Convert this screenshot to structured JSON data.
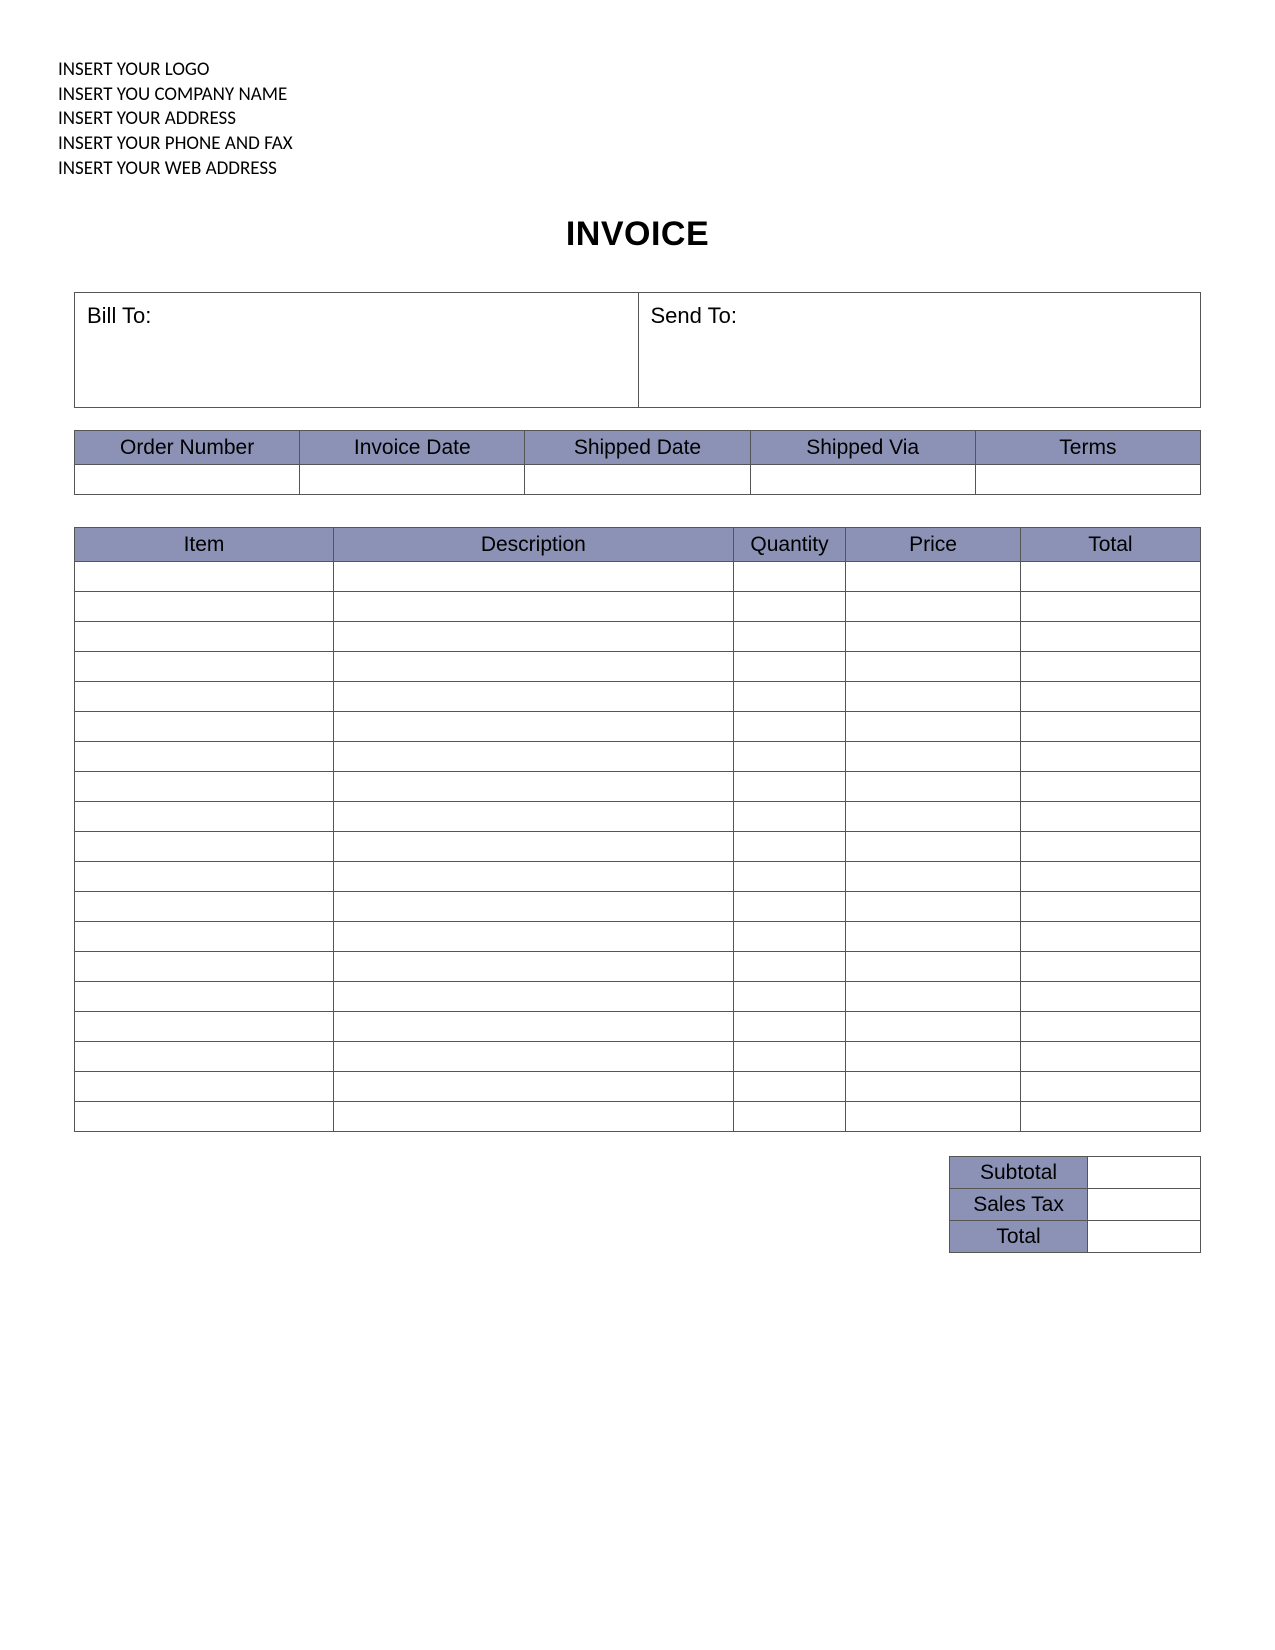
{
  "header": {
    "logo_line": "INSERT YOUR LOGO",
    "company_line": "INSERT YOU COMPANY NAME",
    "address_line": "INSERT YOUR ADDRESS",
    "phone_line": "INSERT YOUR PHONE AND FAX",
    "web_line": "INSERT YOUR WEB ADDRESS"
  },
  "title": "INVOICE",
  "addresses": {
    "bill_to_label": "Bill To:",
    "bill_to_value": "",
    "send_to_label": "Send To:",
    "send_to_value": ""
  },
  "order": {
    "headers": {
      "order_number": "Order Number",
      "invoice_date": "Invoice Date",
      "shipped_date": "Shipped Date",
      "shipped_via": "Shipped Via",
      "terms": "Terms"
    },
    "values": {
      "order_number": "",
      "invoice_date": "",
      "shipped_date": "",
      "shipped_via": "",
      "terms": ""
    }
  },
  "items": {
    "headers": {
      "item": "Item",
      "description": "Description",
      "quantity": "Quantity",
      "price": "Price",
      "total": "Total"
    },
    "rows": [
      {
        "item": "",
        "description": "",
        "quantity": "",
        "price": "",
        "total": ""
      },
      {
        "item": "",
        "description": "",
        "quantity": "",
        "price": "",
        "total": ""
      },
      {
        "item": "",
        "description": "",
        "quantity": "",
        "price": "",
        "total": ""
      },
      {
        "item": "",
        "description": "",
        "quantity": "",
        "price": "",
        "total": ""
      },
      {
        "item": "",
        "description": "",
        "quantity": "",
        "price": "",
        "total": ""
      },
      {
        "item": "",
        "description": "",
        "quantity": "",
        "price": "",
        "total": ""
      },
      {
        "item": "",
        "description": "",
        "quantity": "",
        "price": "",
        "total": ""
      },
      {
        "item": "",
        "description": "",
        "quantity": "",
        "price": "",
        "total": ""
      },
      {
        "item": "",
        "description": "",
        "quantity": "",
        "price": "",
        "total": ""
      },
      {
        "item": "",
        "description": "",
        "quantity": "",
        "price": "",
        "total": ""
      },
      {
        "item": "",
        "description": "",
        "quantity": "",
        "price": "",
        "total": ""
      },
      {
        "item": "",
        "description": "",
        "quantity": "",
        "price": "",
        "total": ""
      },
      {
        "item": "",
        "description": "",
        "quantity": "",
        "price": "",
        "total": ""
      },
      {
        "item": "",
        "description": "",
        "quantity": "",
        "price": "",
        "total": ""
      },
      {
        "item": "",
        "description": "",
        "quantity": "",
        "price": "",
        "total": ""
      },
      {
        "item": "",
        "description": "",
        "quantity": "",
        "price": "",
        "total": ""
      },
      {
        "item": "",
        "description": "",
        "quantity": "",
        "price": "",
        "total": ""
      },
      {
        "item": "",
        "description": "",
        "quantity": "",
        "price": "",
        "total": ""
      },
      {
        "item": "",
        "description": "",
        "quantity": "",
        "price": "",
        "total": ""
      }
    ]
  },
  "totals": {
    "subtotal_label": "Subtotal",
    "subtotal_value": "",
    "sales_tax_label": "Sales Tax",
    "sales_tax_value": "",
    "total_label": "Total",
    "total_value": ""
  }
}
